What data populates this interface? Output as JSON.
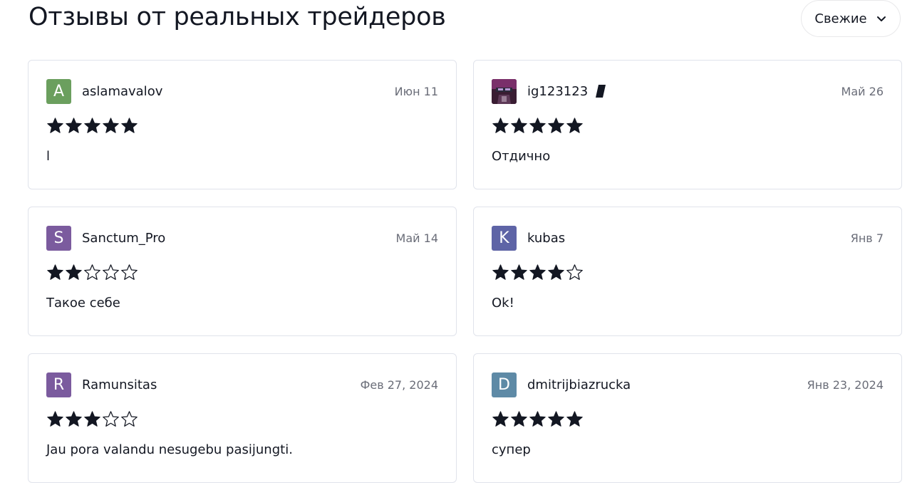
{
  "header": {
    "title": "Отзывы от реальных трейдеров",
    "sort_label": "Свежие",
    "sort_icon": "chevron-down-icon"
  },
  "reviews": [
    {
      "initial": "A",
      "username": "aslamavalov",
      "date": "Июн 11",
      "rating": 5,
      "max_rating": 5,
      "text": "l",
      "avatar_color": "#6b9f5e",
      "avatar_type": "letter",
      "badge": false
    },
    {
      "initial": "",
      "username": "ig123123",
      "date": "Май 26",
      "rating": 5,
      "max_rating": 5,
      "text": "Отдично",
      "avatar_color": "#5b2a4a",
      "avatar_type": "photo",
      "badge": true
    },
    {
      "initial": "S",
      "username": "Sanctum_Pro",
      "date": "Май 14",
      "rating": 2,
      "max_rating": 5,
      "text": "Такое себе",
      "avatar_color": "#7b5b9e",
      "avatar_type": "letter",
      "badge": false
    },
    {
      "initial": "K",
      "username": "kubas",
      "date": "Янв 7",
      "rating": 4,
      "max_rating": 5,
      "text": "Ok!",
      "avatar_color": "#5e64a6",
      "avatar_type": "letter",
      "badge": false
    },
    {
      "initial": "R",
      "username": "Ramunsitas",
      "date": "Фев 27, 2024",
      "rating": 3,
      "max_rating": 5,
      "text": "Jau pora valandu nesugebu pasijungti.",
      "avatar_color": "#7b5b9e",
      "avatar_type": "letter",
      "badge": false
    },
    {
      "initial": "D",
      "username": "dmitrijbiazrucka",
      "date": "Янв 23, 2024",
      "rating": 5,
      "max_rating": 5,
      "text": "супер",
      "avatar_color": "#5e8aa6",
      "avatar_type": "letter",
      "badge": false
    }
  ]
}
